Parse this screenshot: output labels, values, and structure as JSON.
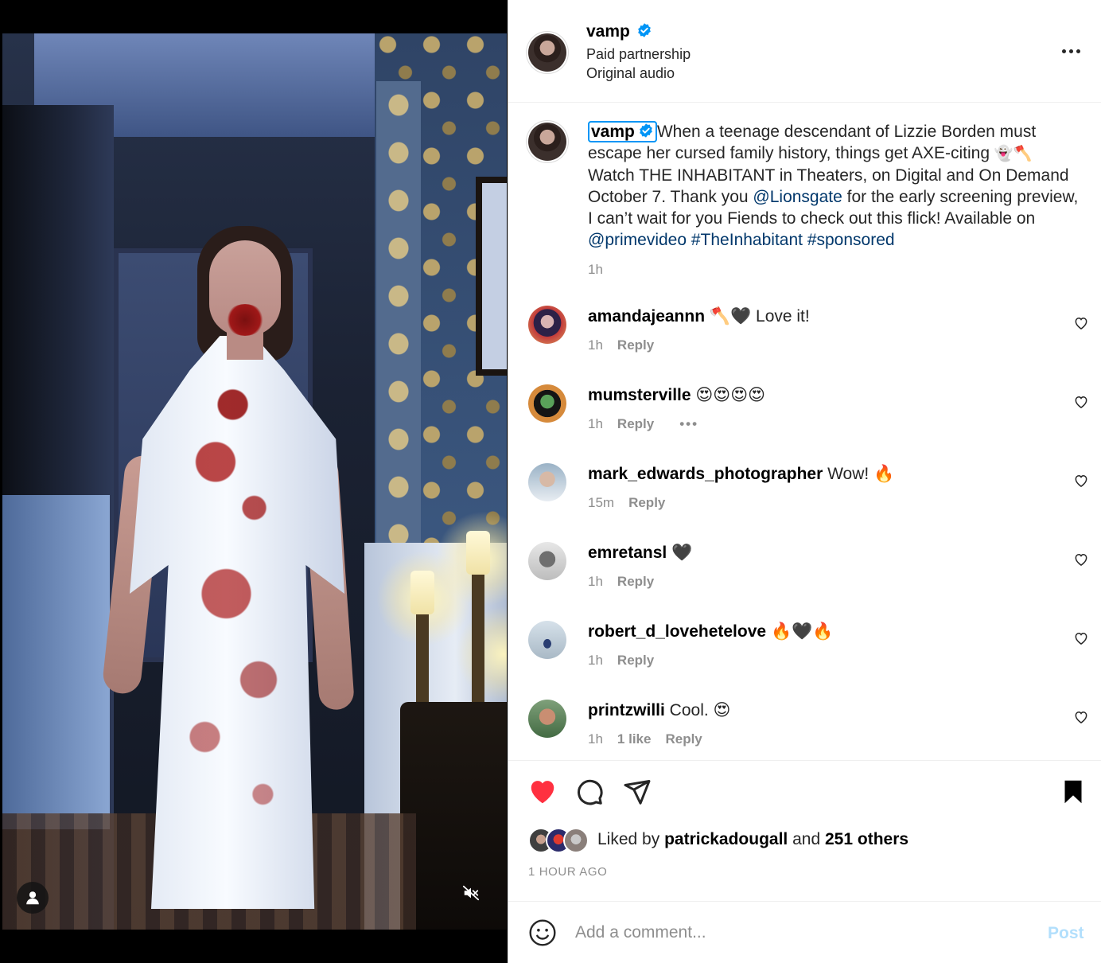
{
  "post": {
    "username": "vamp",
    "verified": true,
    "subtitle_1": "Paid partnership",
    "subtitle_2": "Original audio"
  },
  "caption": {
    "username": "vamp",
    "text_1": "When a teenage descendant of Lizzie Borden must escape her cursed family history, things get AXE-citing ",
    "emoji_1": "👻🪓",
    "text_2": " Watch THE INHABITANT in Theaters, on Digital and On Demand October 7. Thank you ",
    "mention_1": "@Lionsgate",
    "text_3": " for the early screening preview, I can’t wait for you Fiends to check out this flick! Available on ",
    "mention_2": "@primevideo",
    "hashtag_1": "#TheInhabitant",
    "hashtag_2": "#sponsored",
    "time": "1h"
  },
  "comments": [
    {
      "username": "amandajeannn",
      "text": "🪓🖤 Love it!",
      "time": "1h",
      "likes": "",
      "reply": "Reply",
      "show_more": false
    },
    {
      "username": "mumsterville",
      "text": "😍😍😍😍",
      "time": "1h",
      "likes": "",
      "reply": "Reply",
      "show_more": true
    },
    {
      "username": "mark_edwards_photographer",
      "text": "Wow! 🔥",
      "time": "15m",
      "likes": "",
      "reply": "Reply",
      "show_more": false
    },
    {
      "username": "emretansl",
      "text": "🖤",
      "time": "1h",
      "likes": "",
      "reply": "Reply",
      "show_more": false
    },
    {
      "username": "robert_d_lovehetelove",
      "text": "🔥🖤🔥",
      "time": "1h",
      "likes": "",
      "reply": "Reply",
      "show_more": false
    },
    {
      "username": "printzwilli",
      "text": "Cool. 😍",
      "time": "1h",
      "likes": "1 like",
      "reply": "Reply",
      "show_more": false
    }
  ],
  "likes": {
    "prefix": "Liked by",
    "liked_by": "patrickadougall",
    "joiner": "and",
    "others": "251 others"
  },
  "timestamp": "1 HOUR AGO",
  "add_comment": {
    "placeholder": "Add a comment...",
    "post_label": "Post"
  },
  "icons": {
    "like": "heart-filled-icon",
    "comment": "comment-icon",
    "share": "share-icon",
    "save": "bookmark-icon",
    "more": "more-icon",
    "mute": "muted-icon",
    "tagged_user": "user-icon",
    "emoji": "emoji-icon"
  },
  "colors": {
    "like_red": "#ff3040",
    "link_blue": "#00376b",
    "verified_blue": "#0095f6",
    "post_disabled": "#b2dffc",
    "muted_text": "#8e8e8e"
  }
}
